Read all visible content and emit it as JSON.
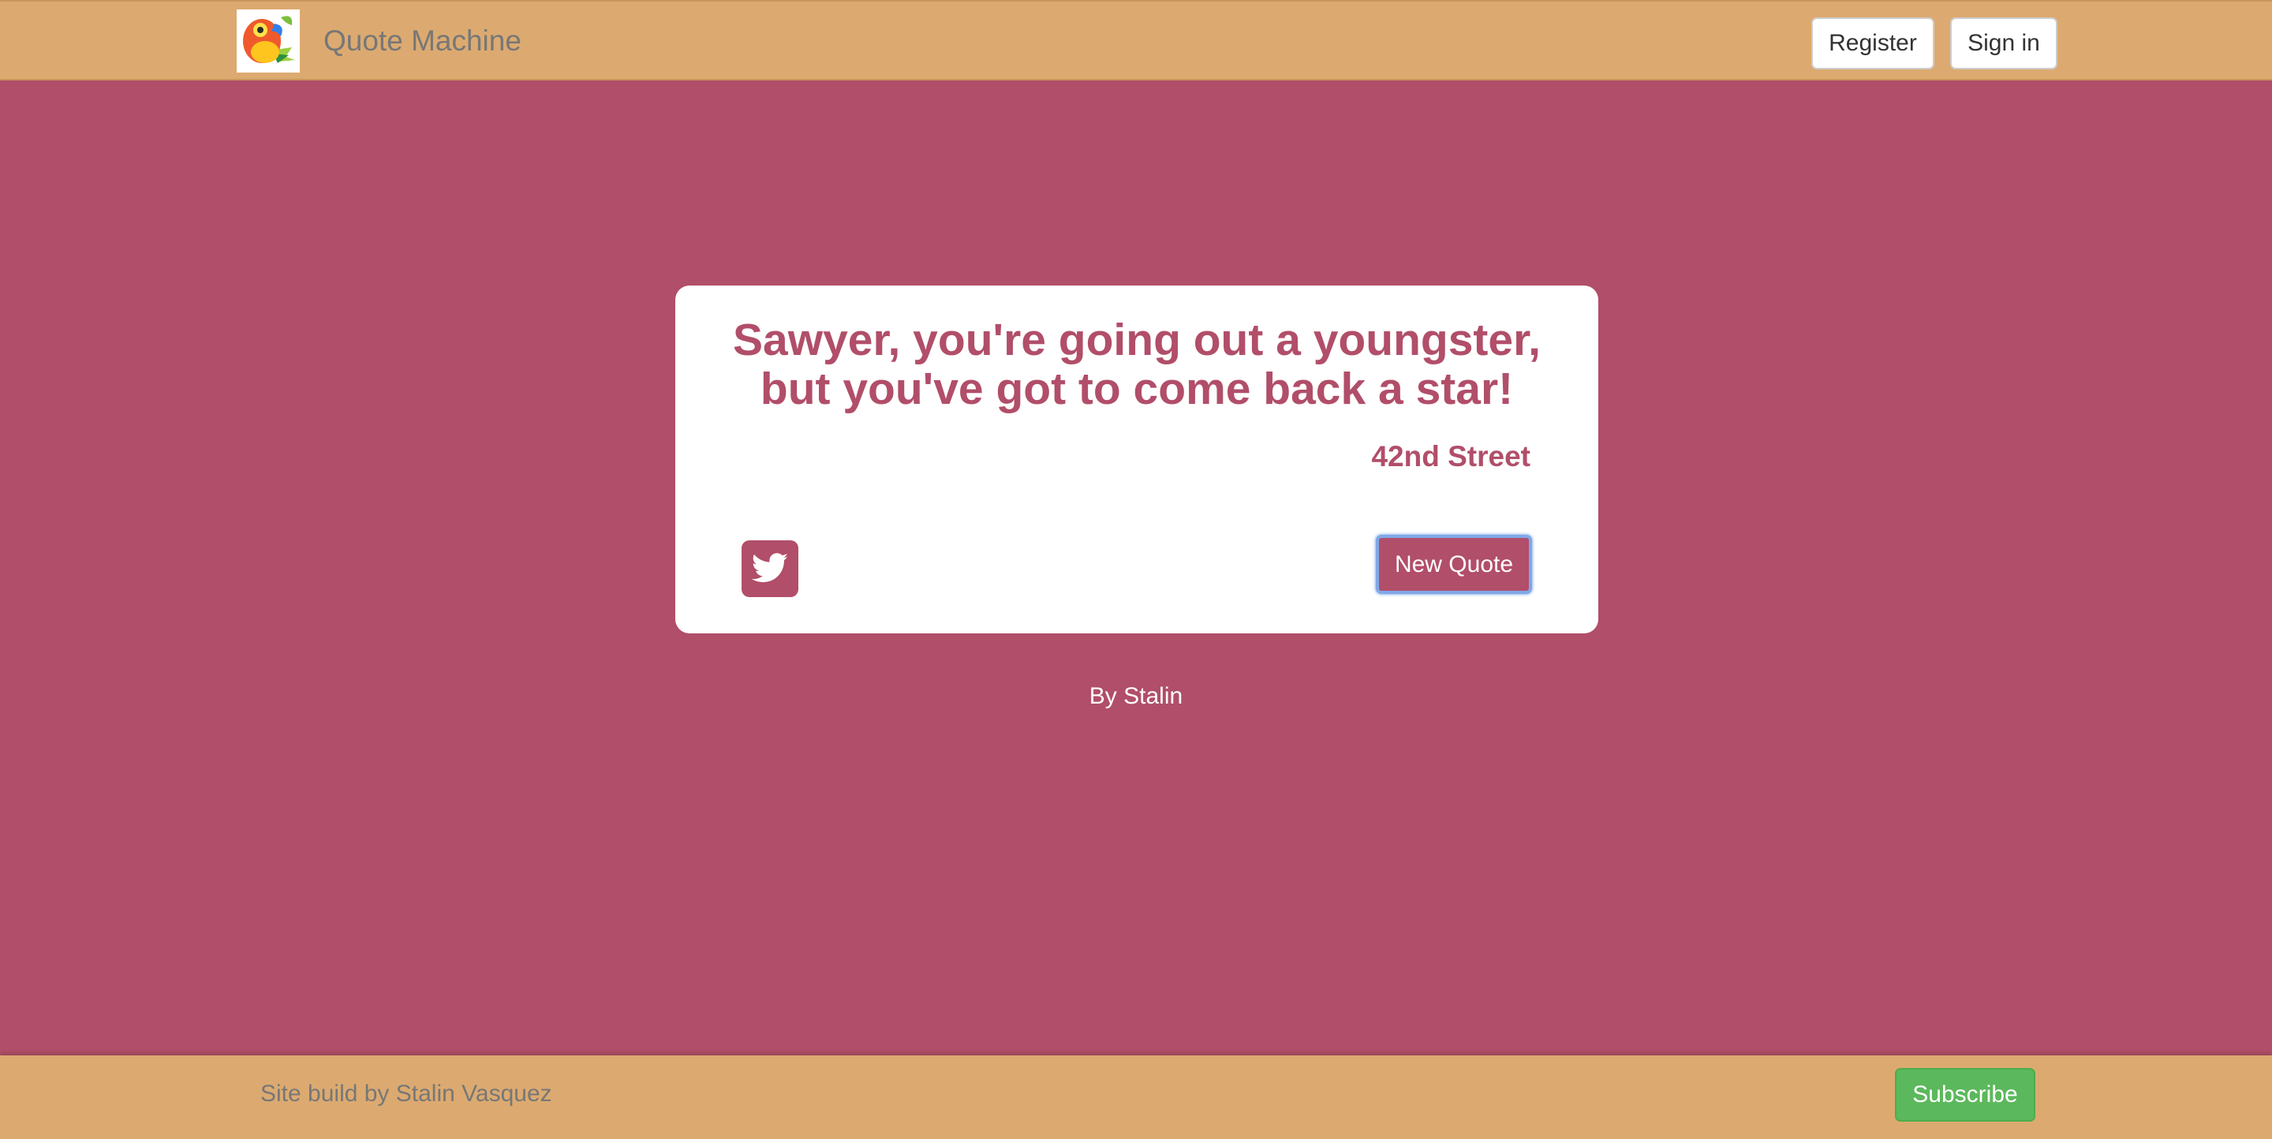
{
  "navbar": {
    "brand_title": "Quote Machine",
    "logo_icon": "bower-bird-logo",
    "register_label": "Register",
    "signin_label": "Sign in"
  },
  "quote": {
    "text": "Sawyer, you're going out a youngster, but you've got to come back a star!",
    "author": "42nd Street",
    "tweet_icon": "twitter-icon",
    "new_quote_label": "New Quote"
  },
  "byline": "By Stalin",
  "footer": {
    "credit": "Site build by Stalin Vasquez",
    "subscribe_label": "Subscribe"
  },
  "colors": {
    "background": "#b14e69",
    "bars": "#dcaa70",
    "subscribe": "#5cb85c"
  }
}
